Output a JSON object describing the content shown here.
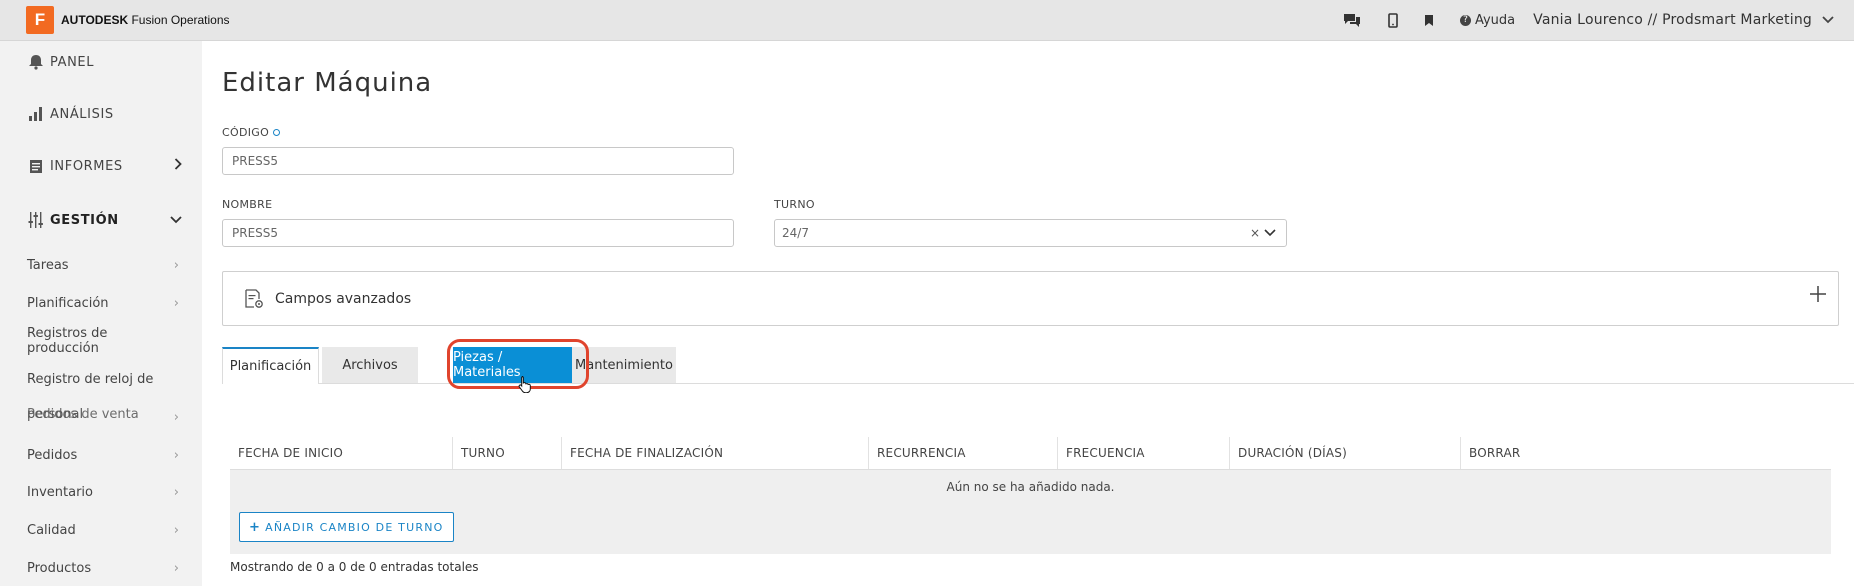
{
  "topbar": {
    "logo_letter": "F",
    "brand_strong": "AUTODESK",
    "brand_light": "Fusion Operations",
    "icons": [
      "chat-icon",
      "mobile-icon",
      "bookmark-icon"
    ],
    "help_label": "Ayuda",
    "user_label": "Vania Lourenco // Prodsmart Marketing"
  },
  "sidebar": {
    "main": [
      {
        "label": "PANEL",
        "icon": "bell-icon"
      },
      {
        "label": "ANÁLISIS",
        "icon": "bar-chart-icon"
      },
      {
        "label": "INFORMES",
        "icon": "report-icon"
      },
      {
        "label": "GESTIÓN",
        "icon": "sliders-icon"
      }
    ],
    "sub": [
      "Tareas",
      "Planificación",
      "Registros de producción",
      "Registro de reloj de",
      "personal",
      "Pedidos de venta",
      "Pedidos",
      "Inventario",
      "Calidad",
      "Productos"
    ]
  },
  "main": {
    "title": "Editar Máquina",
    "codigo_label": "CÓDIGO",
    "codigo_value": "PRESS5",
    "nombre_label": "NOMBRE",
    "nombre_value": "PRESS5",
    "turno_label": "TURNO",
    "turno_value": "24/7",
    "clear_symbol": "×",
    "advanced_label": "Campos avanzados",
    "tabs": [
      "Planificación",
      "Archivos",
      "Piezas / Materiales",
      "Mantenimiento"
    ],
    "active_tab": "Piezas / Materiales",
    "table": {
      "headers": [
        "FECHA DE INICIO",
        "TURNO",
        "FECHA DE FINALIZACIÓN",
        "RECURRENCIA",
        "FRECUENCIA",
        "DURACIÓN (DÍAS)",
        "BORRAR"
      ],
      "empty_text": "Aún no se ha añadido nada.",
      "add_button": "AÑADIR CAMBIO DE TURNO"
    },
    "showing_text": "Mostrando de 0 a 0 de 0 entradas totales"
  },
  "colors": {
    "accent": "#0a8fd6",
    "brand": "#f26a21",
    "highlight": "#e0442d"
  }
}
